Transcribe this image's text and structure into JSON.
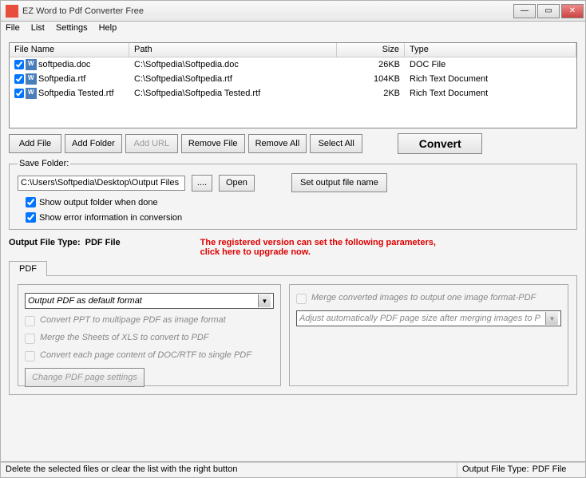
{
  "window": {
    "title": "EZ Word to Pdf Converter Free"
  },
  "menu": {
    "file": "File",
    "list": "List",
    "settings": "Settings",
    "help": "Help"
  },
  "columns": {
    "name": "File Name",
    "path": "Path",
    "size": "Size",
    "type": "Type"
  },
  "files": [
    {
      "name": "softpedia.doc",
      "path": "C:\\Softpedia\\Softpedia.doc",
      "size": "26KB",
      "type": "DOC File"
    },
    {
      "name": "Softpedia.rtf",
      "path": "C:\\Softpedia\\Softpedia.rtf",
      "size": "104KB",
      "type": "Rich Text Document"
    },
    {
      "name": "Softpedia Tested.rtf",
      "path": "C:\\Softpedia\\Softpedia Tested.rtf",
      "size": "2KB",
      "type": "Rich Text Document"
    }
  ],
  "buttons": {
    "addFile": "Add File",
    "addFolder": "Add Folder",
    "addUrl": "Add URL",
    "removeFile": "Remove File",
    "removeAll": "Remove All",
    "selectAll": "Select All",
    "convert": "Convert",
    "browse": "....",
    "open": "Open",
    "setOutput": "Set output file name",
    "changePdf": "Change PDF page settings"
  },
  "save": {
    "legend": "Save Folder:",
    "path": "C:\\Users\\Softpedia\\Desktop\\Output Files",
    "showFolder": "Show output folder when done",
    "showErrors": "Show error information in conversion"
  },
  "output": {
    "label": "Output File Type:",
    "value": "PDF File"
  },
  "upgrade": "The registered version can set the following parameters, click here to upgrade now.",
  "tab": {
    "pdf": "PDF"
  },
  "pdfPanel": {
    "select": "Output PDF as default format",
    "opt1": "Convert PPT to multipage PDF as image format",
    "opt2": "Merge the Sheets of XLS to convert to PDF",
    "opt3": "Convert each page content of DOC/RTF to single PDF",
    "mergeOpt": "Merge converted images to output one image format-PDF",
    "adjustSelect": "Adjust automatically PDF page size after merging images to P"
  },
  "status": {
    "left": "Delete the selected files or clear the list with the right button",
    "rightLabel": "Output File Type:",
    "rightValue": "PDF File"
  }
}
